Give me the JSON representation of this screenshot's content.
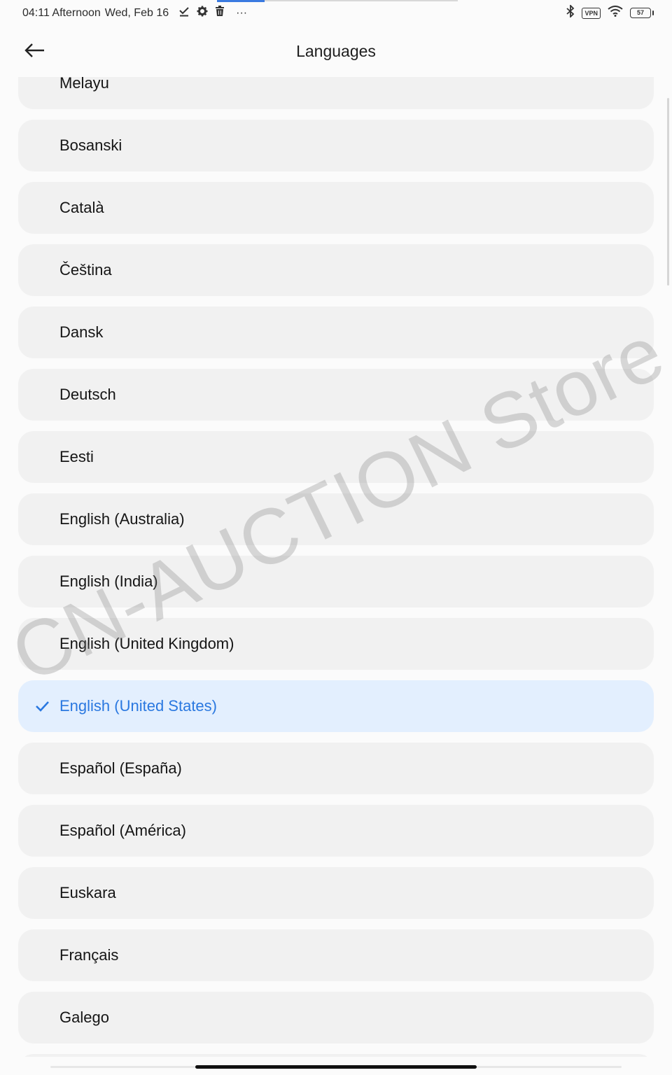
{
  "status_bar": {
    "time": "04:11 Afternoon",
    "date": "Wed, Feb 16",
    "overflow": "···",
    "vpn": "VPN",
    "battery": "57",
    "icons": [
      "check-download-icon",
      "gear-icon",
      "trash-icon",
      "bluetooth-icon",
      "wifi-icon"
    ]
  },
  "header": {
    "title": "Languages",
    "back_icon": "arrow-left-icon"
  },
  "languages": [
    {
      "label": "Melayu",
      "selected": false
    },
    {
      "label": "Bosanski",
      "selected": false
    },
    {
      "label": "Català",
      "selected": false
    },
    {
      "label": "Čeština",
      "selected": false
    },
    {
      "label": "Dansk",
      "selected": false
    },
    {
      "label": "Deutsch",
      "selected": false
    },
    {
      "label": "Eesti",
      "selected": false
    },
    {
      "label": "English (Australia)",
      "selected": false
    },
    {
      "label": "English (India)",
      "selected": false
    },
    {
      "label": "English (United Kingdom)",
      "selected": false
    },
    {
      "label": "English (United States)",
      "selected": true
    },
    {
      "label": "Español (España)",
      "selected": false
    },
    {
      "label": "Español (América)",
      "selected": false
    },
    {
      "label": "Euskara",
      "selected": false
    },
    {
      "label": "Français",
      "selected": false
    },
    {
      "label": "Galego",
      "selected": false
    },
    {
      "label": "",
      "selected": false
    }
  ],
  "watermark": "CN-AUCTION Store",
  "colors": {
    "accent": "#2a78e0",
    "selected_bg": "#e3effe",
    "item_bg": "#f1f1f1"
  }
}
